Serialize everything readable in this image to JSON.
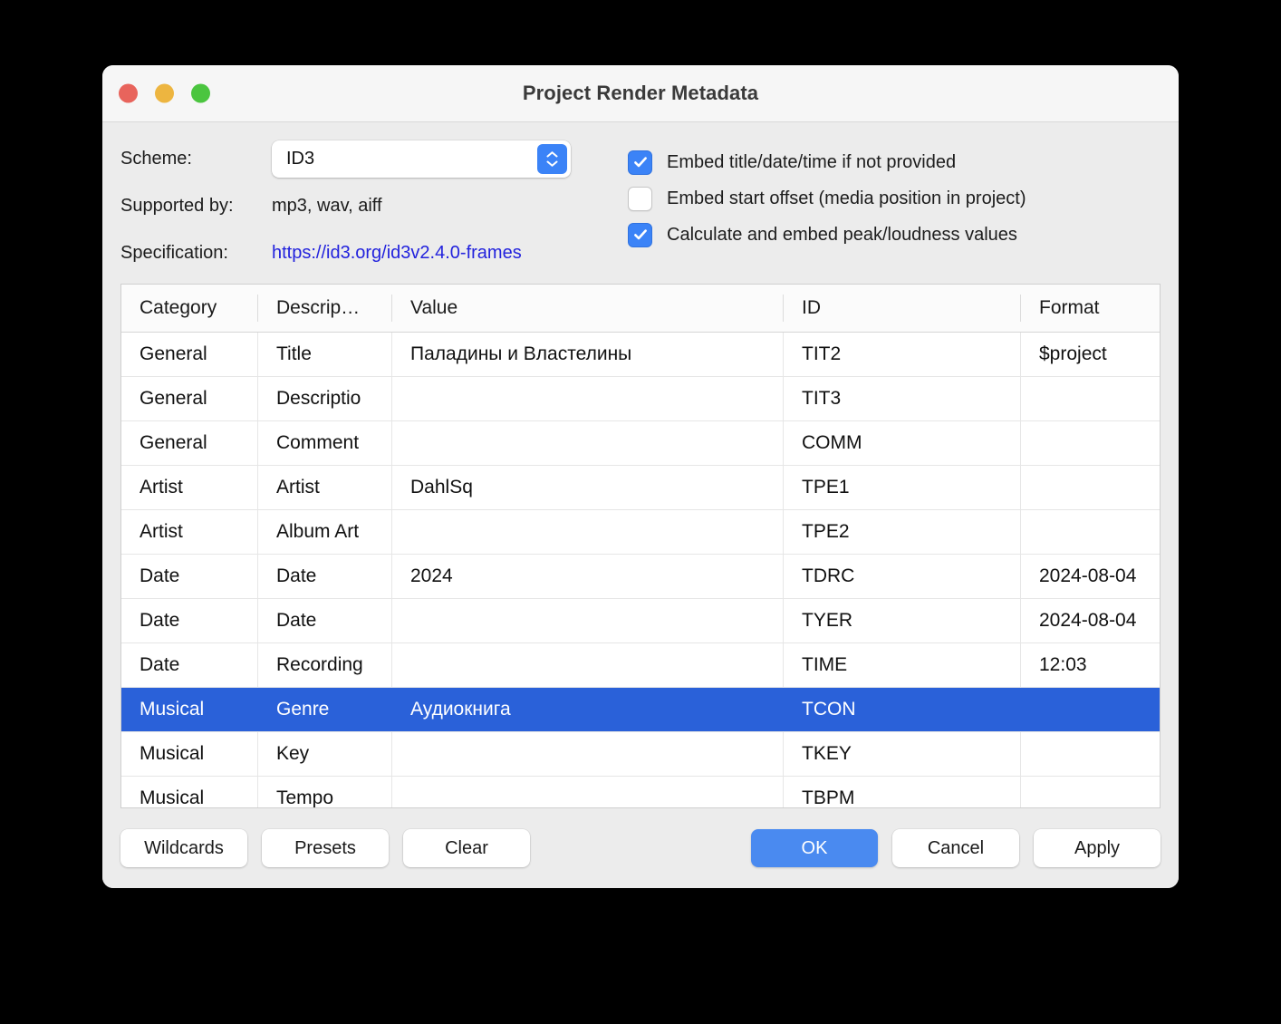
{
  "window": {
    "title": "Project Render Metadata",
    "traffic_lights": [
      "close-button",
      "minimize-button",
      "zoom-button"
    ]
  },
  "options": {
    "scheme_label": "Scheme:",
    "scheme_value": "ID3",
    "supported_by_label": "Supported by:",
    "supported_by_value": "mp3, wav, aiff",
    "specification_label": "Specification:",
    "specification_url": "https://id3.org/id3v2.4.0-frames",
    "checkboxes": [
      {
        "label": "Embed title/date/time if not provided",
        "checked": true
      },
      {
        "label": "Embed start offset (media position in project)",
        "checked": false
      },
      {
        "label": "Calculate and embed peak/loudness values",
        "checked": true
      }
    ]
  },
  "table": {
    "columns": [
      "Category",
      "Descrip…",
      "Value",
      "ID",
      "Format"
    ],
    "selected_row_index": 8,
    "rows": [
      {
        "category": "General",
        "description": "Title",
        "value": "Паладины и Властелины",
        "id": "TIT2",
        "format": "$project"
      },
      {
        "category": "General",
        "description": "Descriptio",
        "value": "",
        "id": "TIT3",
        "format": ""
      },
      {
        "category": "General",
        "description": "Comment",
        "value": "",
        "id": "COMM",
        "format": ""
      },
      {
        "category": "Artist",
        "description": "Artist",
        "value": "DahlSq",
        "id": "TPE1",
        "format": ""
      },
      {
        "category": "Artist",
        "description": "Album Art",
        "value": "",
        "id": "TPE2",
        "format": ""
      },
      {
        "category": "Date",
        "description": "Date",
        "value": "2024",
        "id": "TDRC",
        "format": "2024-08-04"
      },
      {
        "category": "Date",
        "description": "Date",
        "value": "",
        "id": "TYER",
        "format": "2024-08-04"
      },
      {
        "category": "Date",
        "description": "Recording",
        "value": "",
        "id": "TIME",
        "format": "12:03"
      },
      {
        "category": "Musical",
        "description": "Genre",
        "value": "Аудиокнига",
        "id": "TCON",
        "format": ""
      },
      {
        "category": "Musical",
        "description": "Key",
        "value": "",
        "id": "TKEY",
        "format": ""
      },
      {
        "category": "Musical",
        "description": "Tempo",
        "value": "",
        "id": "TBPM",
        "format": ""
      },
      {
        "category": "",
        "description": "",
        "value": "",
        "id": "",
        "format": ""
      }
    ]
  },
  "footer": {
    "wildcards_label": "Wildcards",
    "presets_label": "Presets",
    "clear_label": "Clear",
    "ok_label": "OK",
    "cancel_label": "Cancel",
    "apply_label": "Apply"
  },
  "colors": {
    "selection_blue": "#2a61d9",
    "accent_blue": "#3b83f7",
    "primary_button_blue": "#4a8af0",
    "link_blue": "#2222dd",
    "window_bg": "#ececec",
    "titlebar_bg": "#f6f6f6"
  }
}
